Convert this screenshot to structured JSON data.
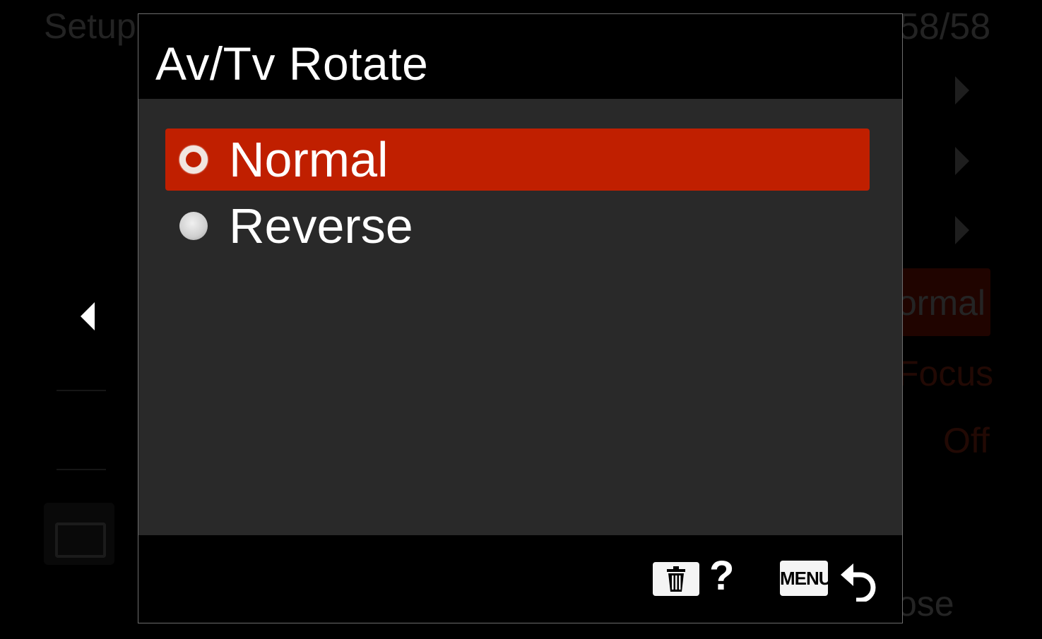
{
  "background_menu": {
    "title": "Setup",
    "page_indicator": "58/58",
    "values": [
      "ormal",
      "Focus",
      "Off",
      "ose"
    ]
  },
  "dialog": {
    "title": "Av/Tv Rotate",
    "options": [
      {
        "label": "Normal",
        "selected": true
      },
      {
        "label": "Reverse",
        "selected": false
      }
    ],
    "footer": {
      "help_label": "?",
      "menu_label": "MENU",
      "trash_icon": "trash-icon",
      "return_icon": "return-arrow-icon"
    }
  },
  "colors": {
    "highlight": "#c01f00",
    "panel": "#292929"
  }
}
